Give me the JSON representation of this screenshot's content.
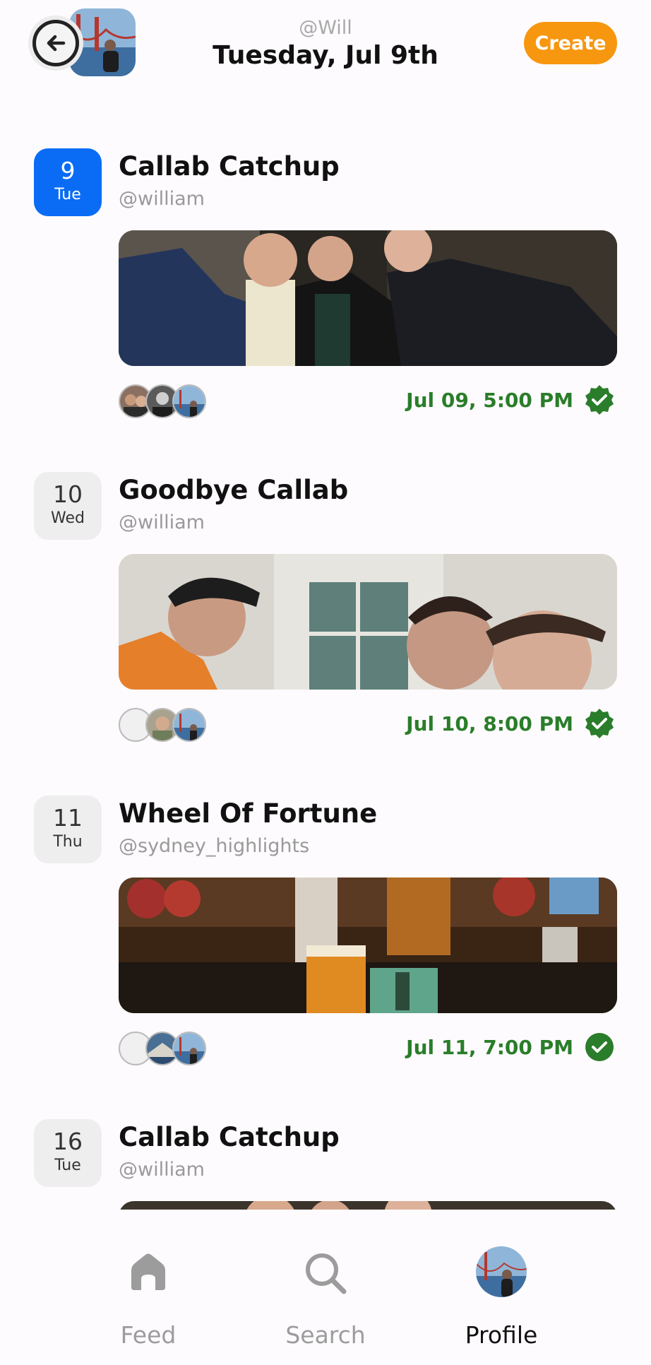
{
  "header": {
    "handle": "@Will",
    "date_title": "Tuesday, Jul 9th",
    "create_label": "Create"
  },
  "events": [
    {
      "day_num": "9",
      "day_wk": "Tue",
      "title": "Callab Catchup",
      "handle": "@william",
      "time": "Jul 09, 5:00 PM",
      "active": true
    },
    {
      "day_num": "10",
      "day_wk": "Wed",
      "title": "Goodbye Callab",
      "handle": "@william",
      "time": "Jul 10, 8:00 PM",
      "active": false
    },
    {
      "day_num": "11",
      "day_wk": "Thu",
      "title": "Wheel Of Fortune",
      "handle": "@sydney_highlights",
      "time": "Jul 11, 7:00 PM",
      "active": false
    },
    {
      "day_num": "16",
      "day_wk": "Tue",
      "title": "Callab Catchup",
      "handle": "@william"
    }
  ],
  "nav": {
    "feed": "Feed",
    "search": "Search",
    "profile": "Profile"
  },
  "colors": {
    "accent_orange": "#f7960f",
    "active_blue": "#0a6cf5",
    "confirmed_green": "#2a7d2a"
  },
  "icons": [
    "back-arrow-icon",
    "home-icon",
    "search-icon",
    "verified-check-icon",
    "check-circle-icon"
  ]
}
